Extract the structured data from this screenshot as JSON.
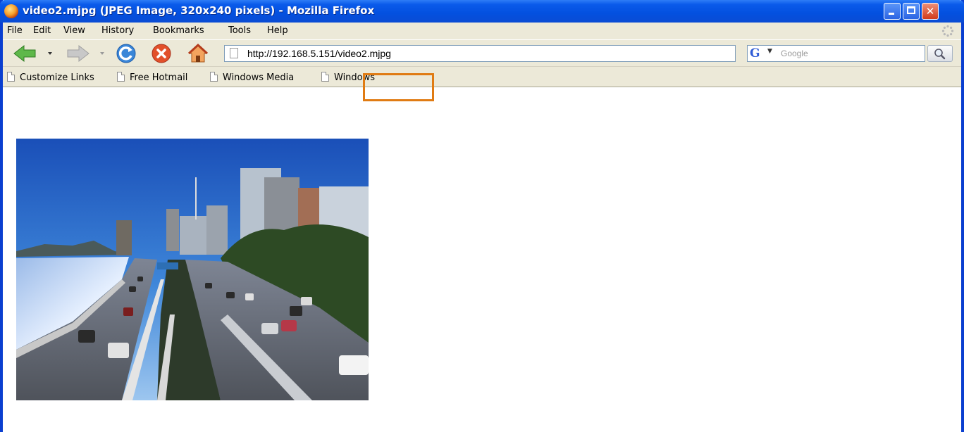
{
  "window": {
    "title": "video2.mjpg (JPEG Image, 320x240 pixels) - Mozilla Firefox",
    "controls": {
      "minimize": "minimize",
      "maximize": "maximize",
      "close": "close"
    }
  },
  "menubar": {
    "items": [
      {
        "label": "File"
      },
      {
        "label": "Edit"
      },
      {
        "label": "View"
      },
      {
        "label": "History"
      },
      {
        "label": "Bookmarks"
      },
      {
        "label": "Tools"
      },
      {
        "label": "Help"
      }
    ]
  },
  "navbar": {
    "url_prefix": "http://192.168.5.151/",
    "url_highlight": "video2.mjpg",
    "search_engine": "G",
    "search_placeholder": "Google"
  },
  "bookmarks": {
    "items": [
      {
        "label": "Customize Links"
      },
      {
        "label": "Free Hotmail"
      },
      {
        "label": "Windows Media"
      },
      {
        "label": "Windows"
      }
    ]
  },
  "colors": {
    "titlebar": "#0A4CD4",
    "chrome": "#ECE9D8",
    "highlight_box": "#E07B13"
  },
  "icons": [
    "firefox-icon",
    "back-arrow-icon",
    "forward-arrow-icon",
    "reload-icon",
    "stop-icon",
    "home-icon",
    "page-icon",
    "go-arrow-icon",
    "search-magnifier-icon",
    "throbber-icon"
  ]
}
